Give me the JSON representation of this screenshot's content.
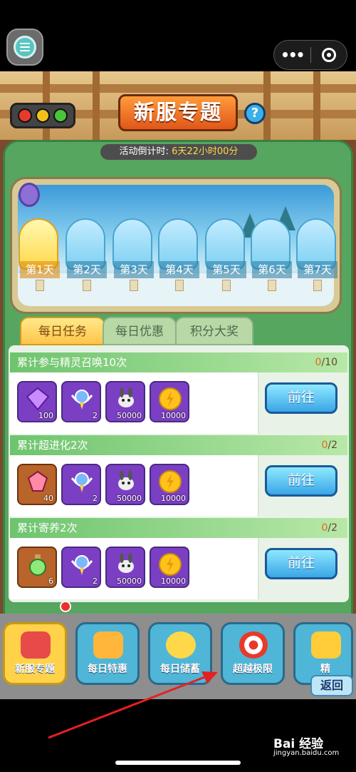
{
  "game": {
    "title": "新服专题",
    "help_icon": "?",
    "countdown_label": "活动倒计时:",
    "countdown_value": "6天22小时00分"
  },
  "days": [
    "第1天",
    "第2天",
    "第3天",
    "第4天",
    "第5天",
    "第6天",
    "第7天"
  ],
  "active_day": 0,
  "tabs": [
    "每日任务",
    "每日优惠",
    "积分大奖"
  ],
  "active_tab": 0,
  "tasks": [
    {
      "title": "累计参与精灵召唤10次",
      "done": "0",
      "total": "/10",
      "first_item_count": "100",
      "button": "前往"
    },
    {
      "title": "累计超进化2次",
      "done": "0",
      "total": "/2",
      "first_item_count": "40",
      "button": "前往"
    },
    {
      "title": "累计寄养2次",
      "done": "0",
      "total": "/2",
      "first_item_count": "6",
      "button": "前往"
    }
  ],
  "shared_rewards": [
    "2",
    "50000",
    "10000"
  ],
  "bottom_nav": [
    "新服专题",
    "每日特惠",
    "每日储蓄",
    "超越极限",
    "精"
  ],
  "back_label": "返回",
  "watermark": {
    "brand": "Bai 经验",
    "url": "jingyan.baidu.com"
  },
  "colors": {
    "accent_orange": "#e0561a",
    "panel_green": "#57a65f",
    "button_blue": "#3aa6e6",
    "annotation_red": "#e52020"
  }
}
